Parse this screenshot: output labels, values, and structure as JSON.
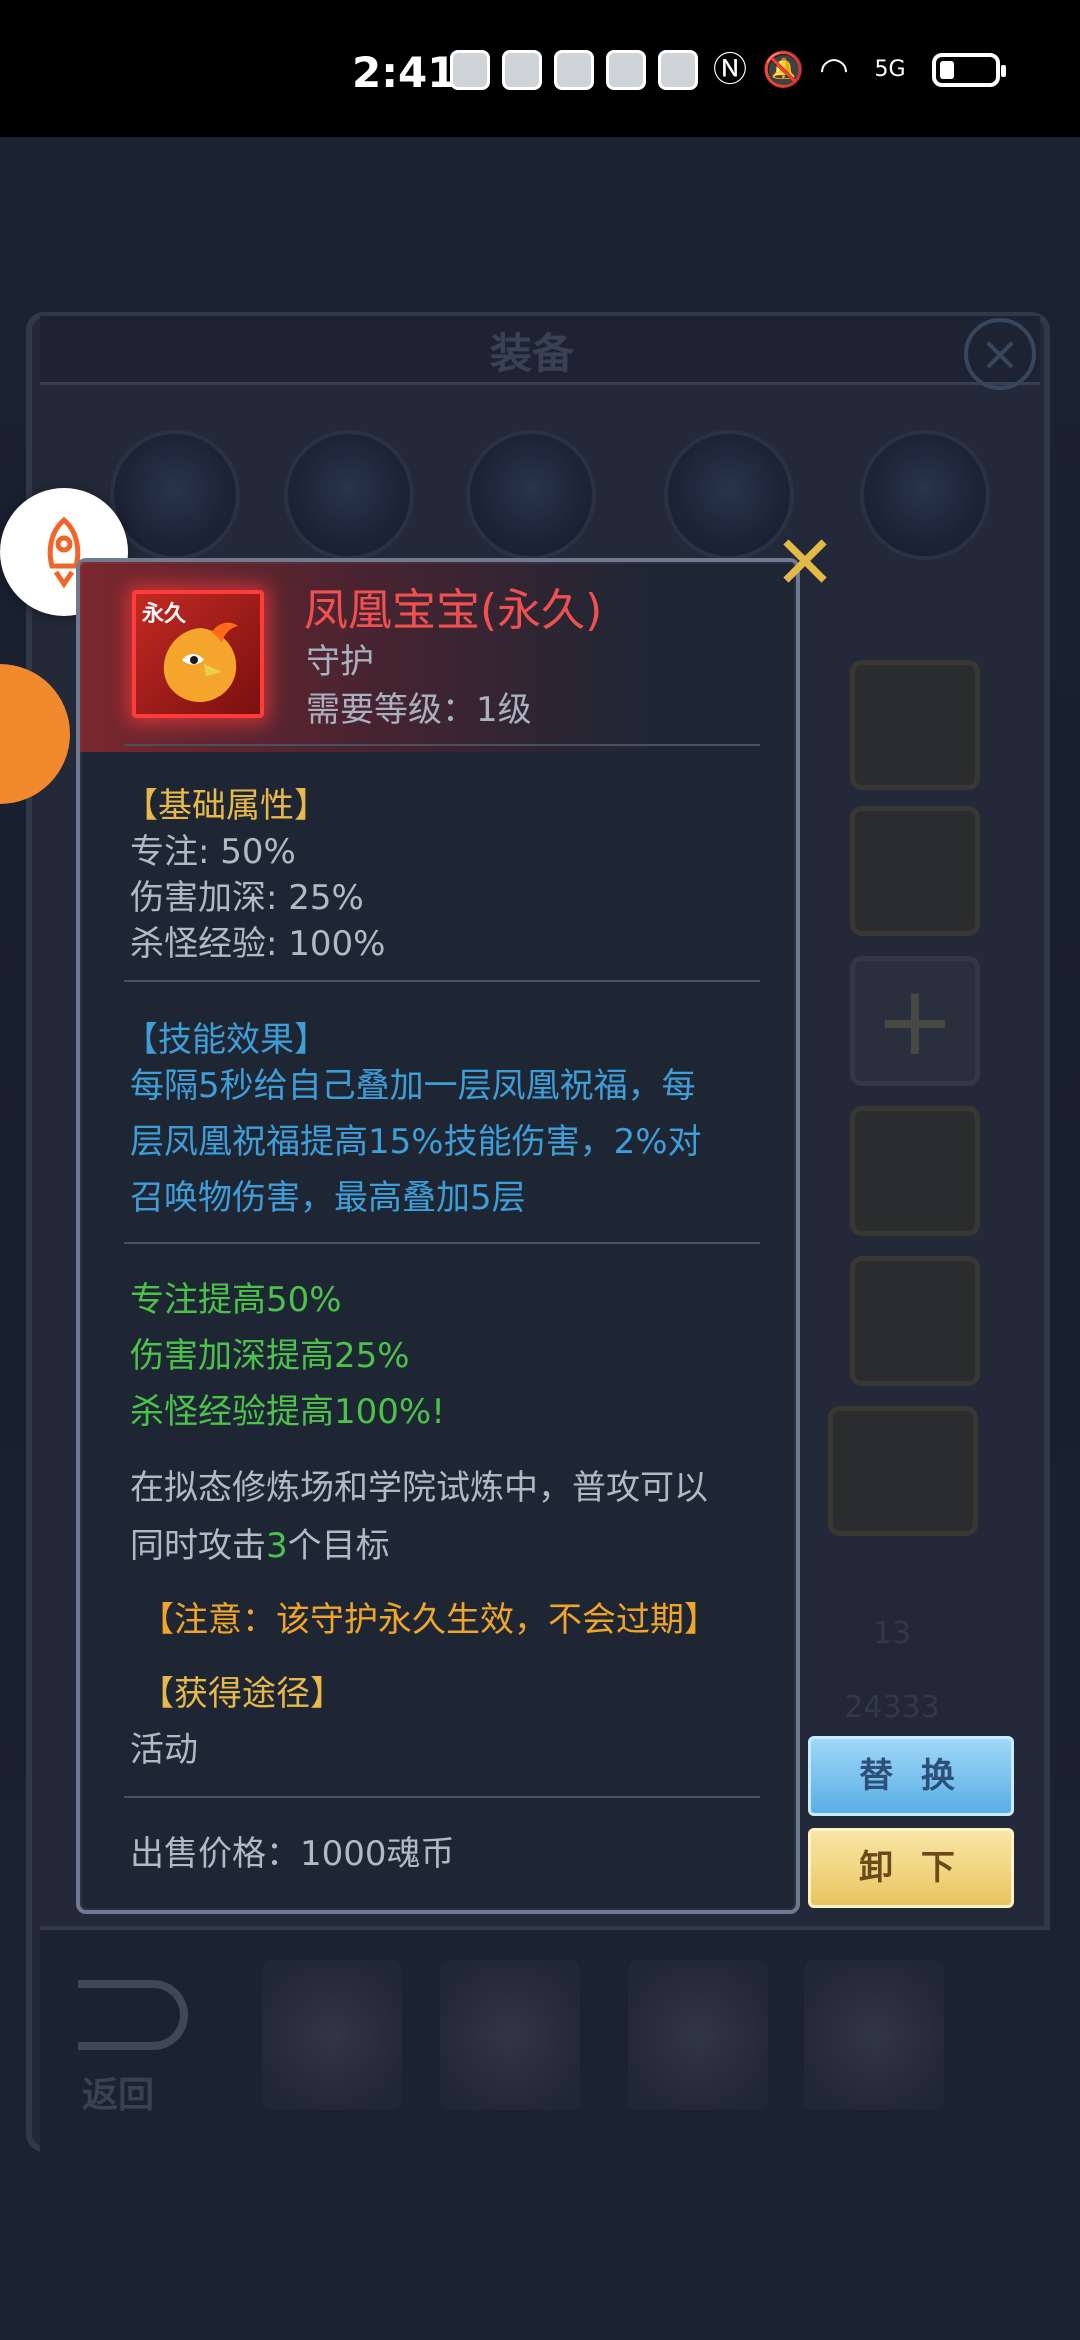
{
  "status_bar": {
    "time": "2:41",
    "signal_label": "5G"
  },
  "background_panel": {
    "title": "装备",
    "side_stats": [
      "13",
      "24333"
    ],
    "replace_button": "替 换",
    "unequip_button": "卸 下",
    "back_label": "返回"
  },
  "tooltip": {
    "icon_tag": "永久",
    "item_name": "凤凰宝宝(永久)",
    "item_type": "守护",
    "required_level": "需要等级：1级",
    "basic_attributes": {
      "header": "【基础属性】",
      "lines": [
        "专注: 50%",
        "伤害加深: 25%",
        "杀怪经验: 100%"
      ]
    },
    "skill_effect": {
      "header": "【技能效果】",
      "lines": [
        "每隔5秒给自己叠加一层凤凰祝福，每",
        "层凤凰祝福提高15%技能伤害，2%对",
        "召唤物伤害，最高叠加5层"
      ]
    },
    "bonuses": [
      "专注提高50%",
      "伤害加深提高25%",
      "杀怪经验提高100%!"
    ],
    "training": {
      "line1": "在拟态修炼场和学院试炼中，普攻可以",
      "line2_before": "同时攻击",
      "line2_number": "3",
      "line2_after": "个目标"
    },
    "notice": "【注意：该守护永久生效，不会过期】",
    "obtain": {
      "header": "【获得途径】",
      "value": "活动"
    },
    "sell_price": "出售价格：1000魂币"
  }
}
